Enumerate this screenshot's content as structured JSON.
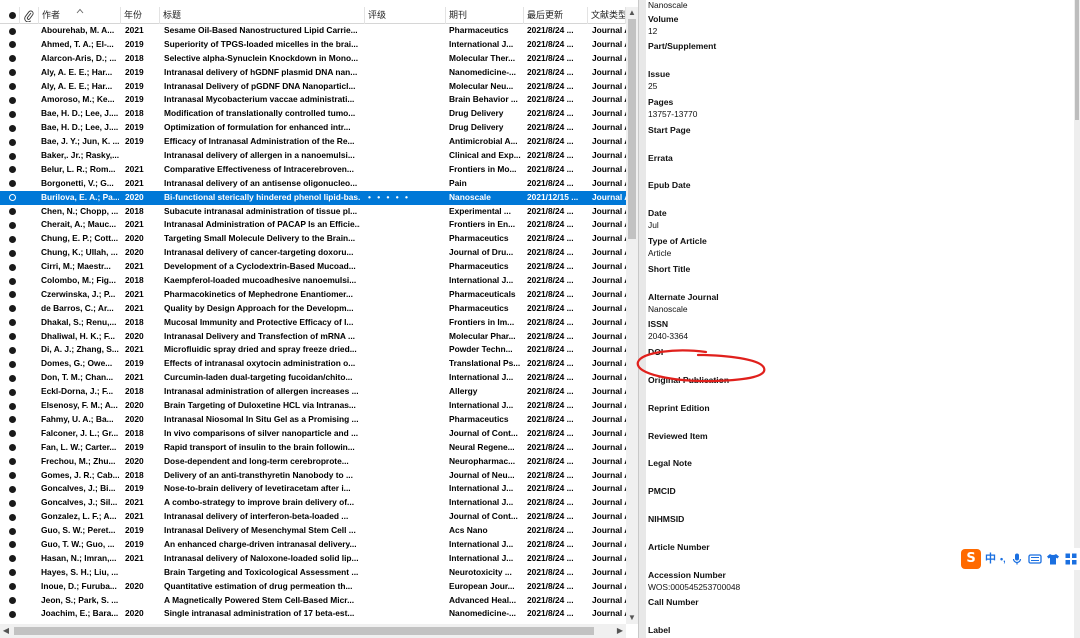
{
  "columns": {
    "author": "作者",
    "year": "年份",
    "title": "标题",
    "rating": "评级",
    "journal": "期刊",
    "updated": "最后更新",
    "type": "文献类型"
  },
  "rows": [
    {
      "author": "Abourehab, M. A...",
      "year": "2021",
      "title": "Sesame Oil-Based Nanostructured Lipid Carrie...",
      "rating": "",
      "journal": "Pharmaceutics",
      "updated": "2021/8/24 ...",
      "type": "Journal A"
    },
    {
      "author": "Ahmed, T. A.; El-...",
      "year": "2019",
      "title": "Superiority of TPGS-loaded micelles in the brai...",
      "rating": "",
      "journal": "International J...",
      "updated": "2021/8/24 ...",
      "type": "Journal A"
    },
    {
      "author": "Alarcon-Aris, D.; ...",
      "year": "2018",
      "title": "Selective alpha-Synuclein Knockdown in Mono...",
      "rating": "",
      "journal": "Molecular Ther...",
      "updated": "2021/8/24 ...",
      "type": "Journal A"
    },
    {
      "author": "Aly, A. E. E.; Har...",
      "year": "2019",
      "title": "Intranasal delivery of hGDNF plasmid DNA nan...",
      "rating": "",
      "journal": "Nanomedicine-...",
      "updated": "2021/8/24 ...",
      "type": "Journal A"
    },
    {
      "author": "Aly, A. E. E.; Har...",
      "year": "2019",
      "title": "Intranasal Delivery of pGDNF DNA Nanoparticl...",
      "rating": "",
      "journal": "Molecular Neu...",
      "updated": "2021/8/24 ...",
      "type": "Journal A"
    },
    {
      "author": "Amoroso, M.; Ke...",
      "year": "2019",
      "title": "Intranasal Mycobacterium vaccae administrati...",
      "rating": "",
      "journal": "Brain Behavior ...",
      "updated": "2021/8/24 ...",
      "type": "Journal A"
    },
    {
      "author": "Bae, H. D.; Lee, J....",
      "year": "2018",
      "title": "Modification of translationally controlled tumo...",
      "rating": "",
      "journal": "Drug Delivery",
      "updated": "2021/8/24 ...",
      "type": "Journal A"
    },
    {
      "author": "Bae, H. D.; Lee, J....",
      "year": "2019",
      "title": "Optimization of formulation for enhanced intr...",
      "rating": "",
      "journal": "Drug Delivery",
      "updated": "2021/8/24 ...",
      "type": "Journal A"
    },
    {
      "author": "Bae, J. Y.; Jun, K. ...",
      "year": "2019",
      "title": "Efficacy of Intranasal Administration of the Re...",
      "rating": "",
      "journal": "Antimicrobial A...",
      "updated": "2021/8/24 ...",
      "type": "Journal A"
    },
    {
      "author": "Baker,. Jr.; Rasky,...",
      "year": "",
      "title": "Intranasal delivery of allergen in a nanoemulsi...",
      "rating": "",
      "journal": "Clinical and Exp...",
      "updated": "2021/8/24 ...",
      "type": "Journal A"
    },
    {
      "author": "Belur, L. R.; Rom...",
      "year": "2021",
      "title": "Comparative Effectiveness of Intracerebroven...",
      "rating": "",
      "journal": "Frontiers in Mo...",
      "updated": "2021/8/24 ...",
      "type": "Journal A"
    },
    {
      "author": "Borgonetti, V.; G...",
      "year": "2021",
      "title": "Intranasal delivery of an antisense oligonucleo...",
      "rating": "",
      "journal": "Pain",
      "updated": "2021/8/24 ...",
      "type": "Journal A"
    },
    {
      "author": "Burilova, E. A.; Pa...",
      "year": "2020",
      "title": "Bi-functional sterically hindered phenol lipid-bas...",
      "rating": "• • • • •",
      "journal": "Nanoscale",
      "updated": "2021/12/15 ...",
      "type": "Journal A",
      "selected": true
    },
    {
      "author": "Chen, N.; Chopp, ...",
      "year": "2018",
      "title": "Subacute intranasal administration of tissue pl...",
      "rating": "",
      "journal": "Experimental ...",
      "updated": "2021/8/24 ...",
      "type": "Journal A"
    },
    {
      "author": "Cherait, A.; Mauc...",
      "year": "2021",
      "title": "Intranasal Administration of PACAP Is an Efficie...",
      "rating": "",
      "journal": "Frontiers in En...",
      "updated": "2021/8/24 ...",
      "type": "Journal A"
    },
    {
      "author": "Chung, E. P.; Cott...",
      "year": "2020",
      "title": "Targeting Small Molecule Delivery to the Brain...",
      "rating": "",
      "journal": "Pharmaceutics",
      "updated": "2021/8/24 ...",
      "type": "Journal A"
    },
    {
      "author": "Chung, K.; Ullah, ...",
      "year": "2020",
      "title": "Intranasal delivery of cancer-targeting doxoru...",
      "rating": "",
      "journal": "Journal of Dru...",
      "updated": "2021/8/24 ...",
      "type": "Journal A"
    },
    {
      "author": "Cirri, M.; Maestr...",
      "year": "2021",
      "title": "Development of a Cyclodextrin-Based Mucoad...",
      "rating": "",
      "journal": "Pharmaceutics",
      "updated": "2021/8/24 ...",
      "type": "Journal A"
    },
    {
      "author": "Colombo, M.; Fig...",
      "year": "2018",
      "title": "Kaempferol-loaded mucoadhesive nanoemulsi...",
      "rating": "",
      "journal": "International J...",
      "updated": "2021/8/24 ...",
      "type": "Journal A"
    },
    {
      "author": "Czerwinska, J.; P...",
      "year": "2021",
      "title": "Pharmacokinetics of Mephedrone Enantiomer...",
      "rating": "",
      "journal": "Pharmaceuticals",
      "updated": "2021/8/24 ...",
      "type": "Journal A"
    },
    {
      "author": "de Barros, C.; Ar...",
      "year": "2021",
      "title": "Quality by Design Approach for the Developm...",
      "rating": "",
      "journal": "Pharmaceutics",
      "updated": "2021/8/24 ...",
      "type": "Journal A"
    },
    {
      "author": "Dhakal, S.; Renu,...",
      "year": "2018",
      "title": "Mucosal Immunity and Protective Efficacy of I...",
      "rating": "",
      "journal": "Frontiers in Im...",
      "updated": "2021/8/24 ...",
      "type": "Journal A"
    },
    {
      "author": "Dhaliwal, H. K.; F...",
      "year": "2020",
      "title": "Intranasal Delivery and Transfection of mRNA ...",
      "rating": "",
      "journal": "Molecular Phar...",
      "updated": "2021/8/24 ...",
      "type": "Journal A"
    },
    {
      "author": "Di, A. J.; Zhang, S...",
      "year": "2021",
      "title": "Microfluidic spray dried and spray freeze dried...",
      "rating": "",
      "journal": "Powder Techn...",
      "updated": "2021/8/24 ...",
      "type": "Journal A"
    },
    {
      "author": "Domes, G.; Owe...",
      "year": "2019",
      "title": "Effects of intranasal oxytocin administration o...",
      "rating": "",
      "journal": "Translational Ps...",
      "updated": "2021/8/24 ...",
      "type": "Journal A"
    },
    {
      "author": "Don, T. M.; Chan...",
      "year": "2021",
      "title": "Curcumin-laden dual-targeting fucoidan/chito...",
      "rating": "",
      "journal": "International J...",
      "updated": "2021/8/24 ...",
      "type": "Journal A"
    },
    {
      "author": "Eckl-Dorna, J.; F...",
      "year": "2018",
      "title": "Intranasal administration of allergen increases ...",
      "rating": "",
      "journal": "Allergy",
      "updated": "2021/8/24 ...",
      "type": "Journal A"
    },
    {
      "author": "Elsenosy, F. M.; A...",
      "year": "2020",
      "title": "Brain Targeting of Duloxetine HCL via Intranas...",
      "rating": "",
      "journal": "International J...",
      "updated": "2021/8/24 ...",
      "type": "Journal A"
    },
    {
      "author": "Fahmy, U. A.; Ba...",
      "year": "2020",
      "title": "Intranasal Niosomal In Situ Gel as a Promising ...",
      "rating": "",
      "journal": "Pharmaceutics",
      "updated": "2021/8/24 ...",
      "type": "Journal A"
    },
    {
      "author": "Falconer, J. L.; Gr...",
      "year": "2018",
      "title": "In vivo comparisons of silver nanoparticle and ...",
      "rating": "",
      "journal": "Journal of Cont...",
      "updated": "2021/8/24 ...",
      "type": "Journal A"
    },
    {
      "author": "Fan, L. W.; Carter...",
      "year": "2019",
      "title": "Rapid transport of insulin to the brain followin...",
      "rating": "",
      "journal": "Neural Regene...",
      "updated": "2021/8/24 ...",
      "type": "Journal A"
    },
    {
      "author": "Frechou, M.; Zhu...",
      "year": "2020",
      "title": "Dose-dependent and long-term cerebroprote...",
      "rating": "",
      "journal": "Neuropharmac...",
      "updated": "2021/8/24 ...",
      "type": "Journal A"
    },
    {
      "author": "Gomes, J. R.; Cab...",
      "year": "2018",
      "title": "Delivery of an anti-transthyretin Nanobody to ...",
      "rating": "",
      "journal": "Journal of Neu...",
      "updated": "2021/8/24 ...",
      "type": "Journal A"
    },
    {
      "author": "Goncalves, J.; Bi...",
      "year": "2019",
      "title": "Nose-to-brain delivery of levetiracetam after i...",
      "rating": "",
      "journal": "International J...",
      "updated": "2021/8/24 ...",
      "type": "Journal A"
    },
    {
      "author": "Goncalves, J.; Sil...",
      "year": "2021",
      "title": "A combo-strategy to improve brain delivery of...",
      "rating": "",
      "journal": "International J...",
      "updated": "2021/8/24 ...",
      "type": "Journal A"
    },
    {
      "author": "Gonzalez, L. F.; A...",
      "year": "2021",
      "title": "Intranasal delivery of interferon-beta-loaded ...",
      "rating": "",
      "journal": "Journal of Cont...",
      "updated": "2021/8/24 ...",
      "type": "Journal A"
    },
    {
      "author": "Guo, S. W.; Peret...",
      "year": "2019",
      "title": "Intranasal Delivery of Mesenchymal Stem Cell ...",
      "rating": "",
      "journal": "Acs Nano",
      "updated": "2021/8/24 ...",
      "type": "Journal A"
    },
    {
      "author": "Guo, T. W.; Guo, ...",
      "year": "2019",
      "title": "An enhanced charge-driven intranasal delivery...",
      "rating": "",
      "journal": "International J...",
      "updated": "2021/8/24 ...",
      "type": "Journal A"
    },
    {
      "author": "Hasan, N.; Imran,...",
      "year": "2021",
      "title": "Intranasal delivery of Naloxone-loaded solid lip...",
      "rating": "",
      "journal": "International J...",
      "updated": "2021/8/24 ...",
      "type": "Journal A"
    },
    {
      "author": "Hayes, S. H.; Liu, ...",
      "year": "",
      "title": "Brain Targeting and Toxicological Assessment ...",
      "rating": "",
      "journal": "Neurotoxicity ...",
      "updated": "2021/8/24 ...",
      "type": "Journal A"
    },
    {
      "author": "Inoue, D.; Furuba...",
      "year": "2020",
      "title": "Quantitative estimation of drug permeation th...",
      "rating": "",
      "journal": "European Jour...",
      "updated": "2021/8/24 ...",
      "type": "Journal A"
    },
    {
      "author": "Jeon, S.; Park, S. ...",
      "year": "",
      "title": "A Magnetically Powered Stem Cell-Based Micr...",
      "rating": "",
      "journal": "Advanced Heal...",
      "updated": "2021/8/24 ...",
      "type": "Journal A"
    },
    {
      "author": "Joachim, E.; Bara...",
      "year": "2020",
      "title": "Single intranasal administration of 17 beta-est...",
      "rating": "",
      "journal": "Nanomedicine-...",
      "updated": "2021/8/24 ...",
      "type": "Journal A"
    }
  ],
  "fields": [
    {
      "label": "",
      "value": "Nanoscale"
    },
    {
      "label": "Volume",
      "value": "12"
    },
    {
      "label": "Part/Supplement",
      "value": ""
    },
    {
      "label": "Issue",
      "value": "25"
    },
    {
      "label": "Pages",
      "value": "13757-13770"
    },
    {
      "label": "Start Page",
      "value": ""
    },
    {
      "label": "Errata",
      "value": ""
    },
    {
      "label": "Epub Date",
      "value": ""
    },
    {
      "label": "Date",
      "value": "Jul"
    },
    {
      "label": "Type of Article",
      "value": "Article"
    },
    {
      "label": "Short Title",
      "value": ""
    },
    {
      "label": "Alternate Journal",
      "value": "Nanoscale"
    },
    {
      "label": "ISSN",
      "value": "2040-3364"
    },
    {
      "label": "DOI",
      "value": ""
    },
    {
      "label": "Original Publication",
      "value": ""
    },
    {
      "label": "Reprint Edition",
      "value": ""
    },
    {
      "label": "Reviewed Item",
      "value": ""
    },
    {
      "label": "Legal Note",
      "value": ""
    },
    {
      "label": "PMCID",
      "value": ""
    },
    {
      "label": "NIHMSID",
      "value": ""
    },
    {
      "label": "Article Number",
      "value": ""
    },
    {
      "label": "Accession Number",
      "value": "WOS:000545253700048"
    },
    {
      "label": "Call Number",
      "value": ""
    },
    {
      "label": "Label",
      "value": ""
    }
  ],
  "ime": {
    "logo": "S",
    "mode": "中",
    "punct": "•,"
  },
  "colors": {
    "selection": "#0078d7",
    "annotation": "#e0201c",
    "ime_brand": "#ff6a00",
    "ime_icon": "#1a6fe0"
  }
}
